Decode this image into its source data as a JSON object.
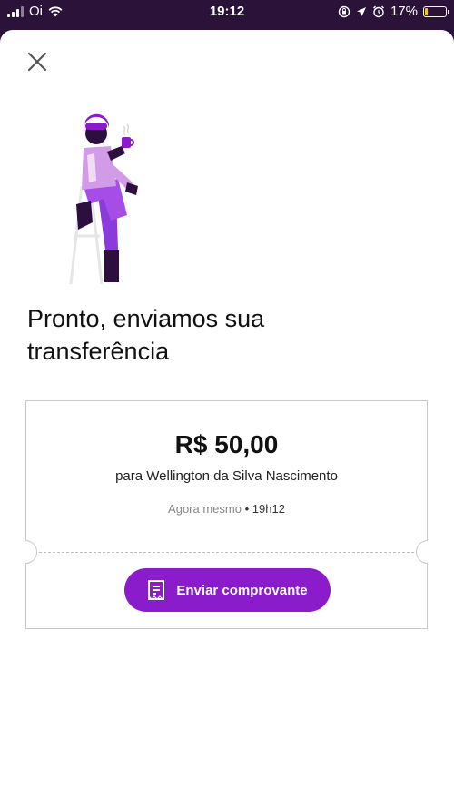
{
  "status_bar": {
    "carrier": "Oi",
    "time": "19:12",
    "battery_percent": "17%",
    "battery_level": 0.17,
    "icons": [
      "signal-icon",
      "wifi-icon",
      "screen-rotation-lock-icon",
      "location-icon",
      "alarm-icon",
      "battery-icon"
    ]
  },
  "colors": {
    "accent": "#8a1ccc",
    "status_bar_bg": "#2a1238",
    "battery_fill": "#f5c518"
  },
  "header": {
    "close_icon": "close-icon"
  },
  "title": "Pronto, enviamos sua transferência",
  "receipt": {
    "amount": "R$ 50,00",
    "recipient": "para Wellington da Silva Nascimento",
    "time_relative": "Agora mesmo",
    "time_separator": "•",
    "time_exact": "19h12",
    "button_label": "Enviar comprovante",
    "button_icon": "document-icon"
  }
}
